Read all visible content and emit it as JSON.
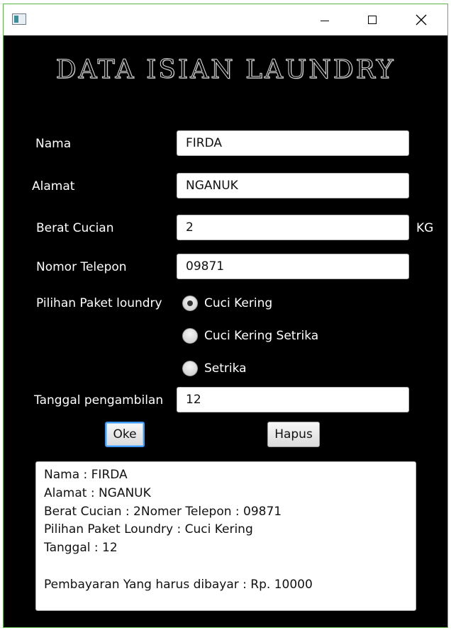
{
  "window": {
    "controls": {
      "minimize": "minimize-icon",
      "maximize": "maximize-icon",
      "close": "close-icon"
    }
  },
  "heading": "DATA ISIAN LAUNDRY",
  "form": {
    "nama_label": "Nama",
    "nama_value": "FIRDA",
    "alamat_label": "Alamat",
    "alamat_value": "NGANUK",
    "berat_label": "Berat Cucian",
    "berat_value": "2",
    "berat_unit": "KG",
    "telepon_label": "Nomor Telepon",
    "telepon_value": "09871",
    "paket_label": "Pilihan Paket loundry",
    "paket_options": [
      {
        "label": "Cuci Kering",
        "selected": true
      },
      {
        "label": "Cuci Kering Setrika",
        "selected": false
      },
      {
        "label": "Setrika",
        "selected": false
      }
    ],
    "tanggal_label": "Tanggal pengambilan",
    "tanggal_value": "12"
  },
  "buttons": {
    "oke": "Oke",
    "hapus": "Hapus"
  },
  "output_lines": [
    "Nama : FIRDA",
    "Alamat : NGANUK",
    "Berat Cucian : 2Nomer Telepon : 09871",
    "Pilihan Paket Loundry : Cuci Kering",
    "Tanggal : 12",
    "",
    "Pembayaran Yang harus dibayar : Rp. 10000"
  ],
  "colors": {
    "window_bg": "#000000",
    "accent_focus": "#3b99fc",
    "window_border": "#5ab64a"
  }
}
